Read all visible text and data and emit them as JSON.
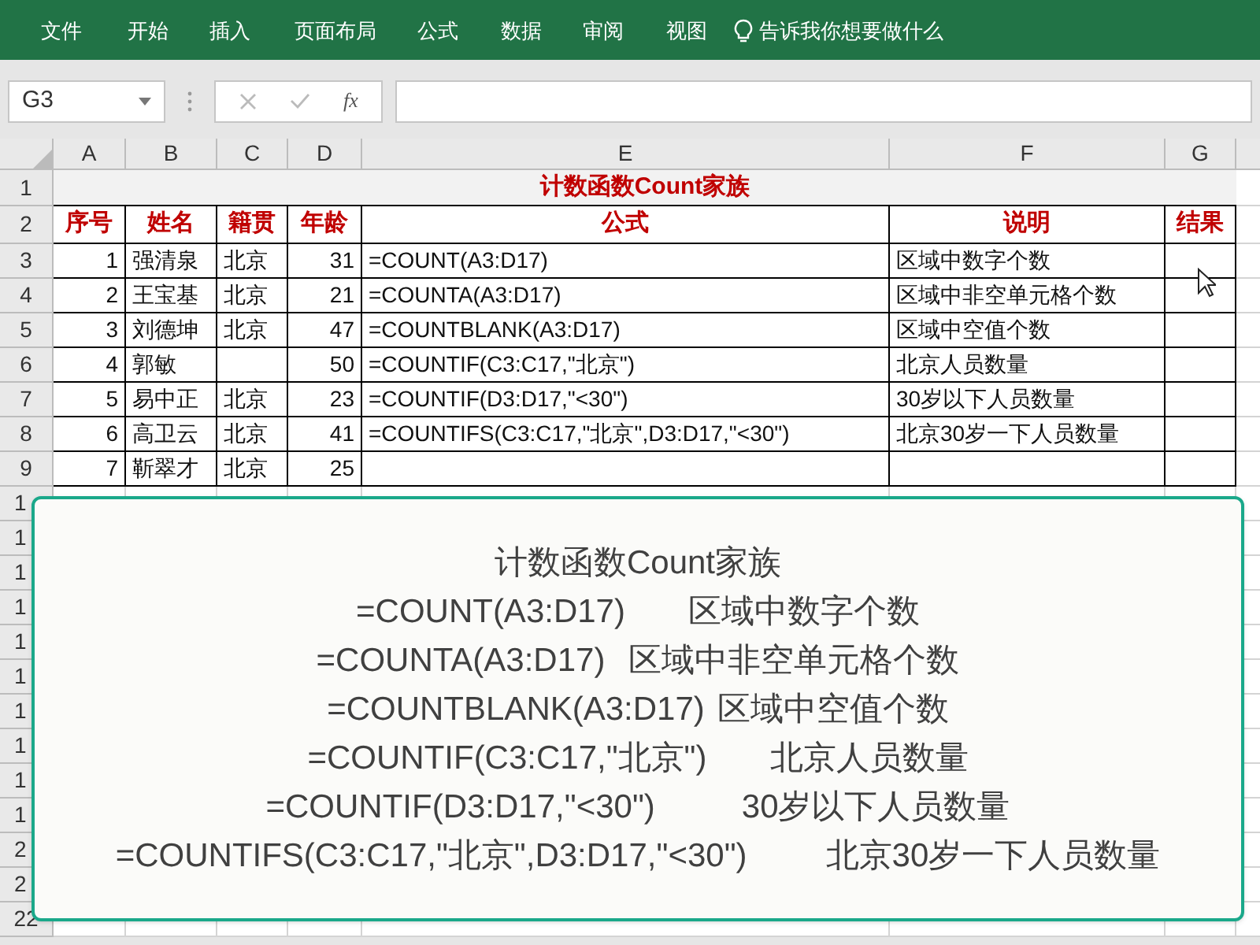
{
  "ribbon": {
    "tabs": [
      "文件",
      "开始",
      "插入",
      "页面布局",
      "公式",
      "数据",
      "审阅",
      "视图"
    ],
    "tell_me": "告诉我你想要做什么"
  },
  "formula_bar": {
    "name_box": "G3",
    "function_label": "fx"
  },
  "sheet": {
    "columns": [
      "A",
      "B",
      "C",
      "D",
      "E",
      "F",
      "G"
    ],
    "title": "计数函数Count家族",
    "headers": [
      "序号",
      "姓名",
      "籍贯",
      "年龄",
      "公式",
      "说明",
      "结果"
    ],
    "rows": [
      {
        "no": "1",
        "name": "强清泉",
        "origin": "北京",
        "age": "31",
        "formula": "=COUNT(A3:D17)",
        "note": "区域中数字个数"
      },
      {
        "no": "2",
        "name": "王宝基",
        "origin": "北京",
        "age": "21",
        "formula": "=COUNTA(A3:D17)",
        "note": "区域中非空单元格个数"
      },
      {
        "no": "3",
        "name": "刘德坤",
        "origin": "北京",
        "age": "47",
        "formula": "=COUNTBLANK(A3:D17)",
        "note": "区域中空值个数"
      },
      {
        "no": "4",
        "name": "郭敏",
        "age": "50",
        "formula": "=COUNTIF(C3:C17,\"北京\")",
        "note": "北京人员数量"
      },
      {
        "no": "5",
        "name": "易中正",
        "origin": "北京",
        "age": "23",
        "formula": "=COUNTIF(D3:D17,\"<30\")",
        "note": "30岁以下人员数量"
      },
      {
        "no": "6",
        "name": "高卫云",
        "origin": "北京",
        "age": "41",
        "formula": "=COUNTIFS(C3:C17,\"北京\",D3:D17,\"<30\")",
        "note": "北京30岁一下人员数量"
      },
      {
        "no": "7",
        "name": "靳翠才",
        "origin": "北京",
        "age": "25"
      }
    ],
    "row_numbers": [
      "1",
      "2",
      "3",
      "4",
      "5",
      "6",
      "7",
      "8",
      "9",
      "1",
      "1",
      "1",
      "1",
      "1",
      "1",
      "1",
      "1",
      "1",
      "1",
      "2",
      "2",
      "22"
    ]
  },
  "callout": {
    "title": "计数函数Count家族",
    "lines": [
      {
        "formula": "=COUNT(A3:D17)",
        "note": "区域中数字个数"
      },
      {
        "formula": "=COUNTA(A3:D17)",
        "note": "区域中非空单元格个数"
      },
      {
        "formula": "=COUNTBLANK(A3:D17)",
        "note": "区域中空值个数"
      },
      {
        "formula": "=COUNTIF(C3:C17,\"北京\")",
        "note": "北京人员数量"
      },
      {
        "formula": "=COUNTIF(D3:D17,\"<30\")",
        "note": "30岁以下人员数量"
      },
      {
        "formula": "=COUNTIFS(C3:C17,\"北京\",D3:D17,\"<30\")",
        "note": "北京30岁一下人员数量"
      }
    ]
  }
}
